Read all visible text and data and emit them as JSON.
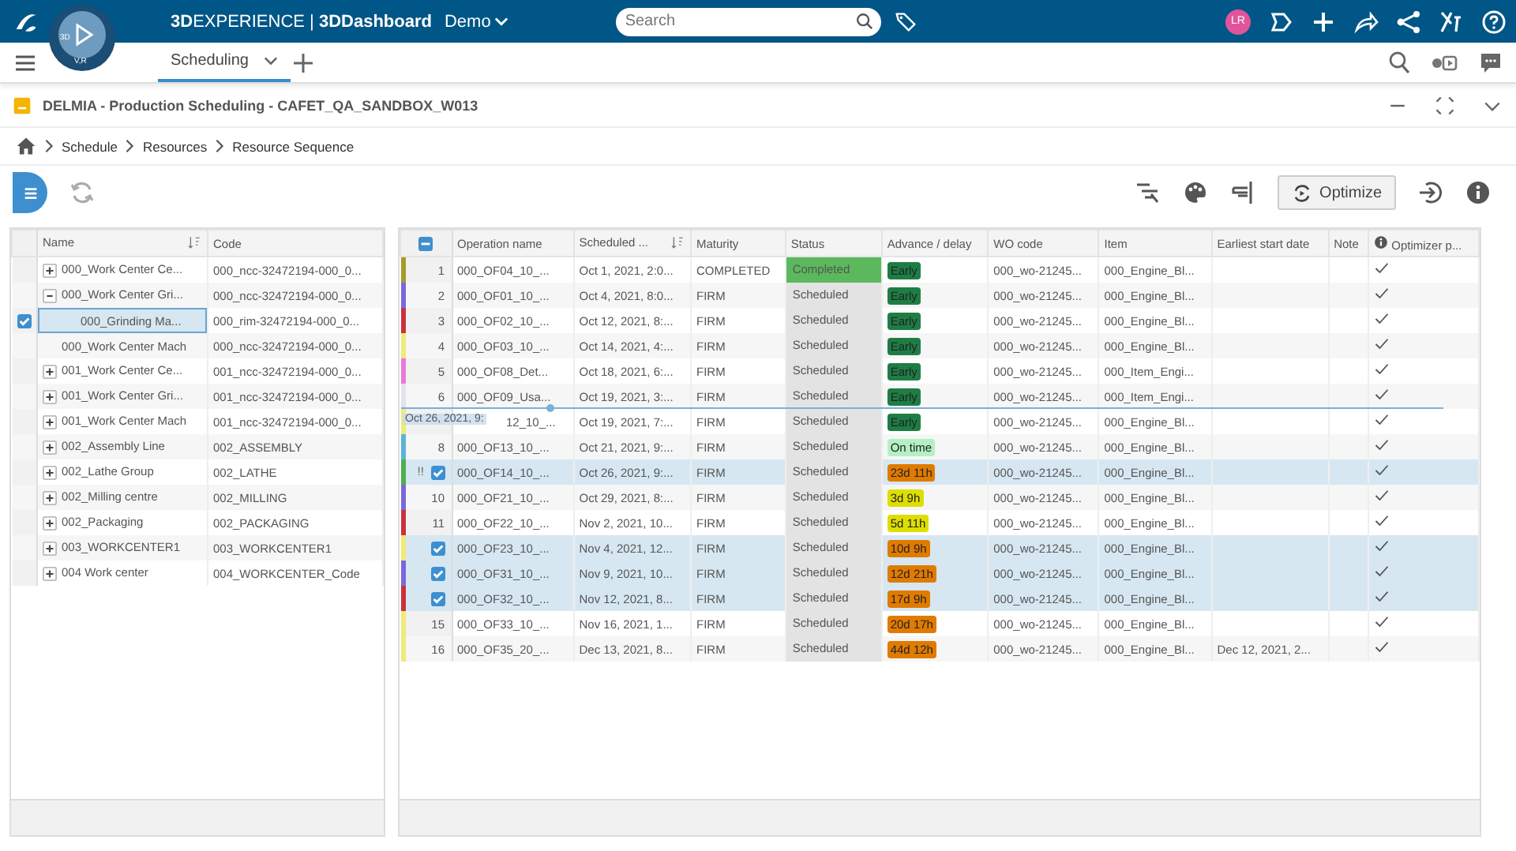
{
  "topbar": {
    "compass_labels": [
      "3D",
      "V,R"
    ],
    "brand": "**3D**EXPERIENCE | **3DDashboard**",
    "space": "Demo",
    "search": {
      "placeholder": "Search"
    },
    "avatar": "LR"
  },
  "tabs": [
    {
      "label": "Scheduling",
      "selected": true
    }
  ],
  "widget": {
    "title": "DELMIA - Production Scheduling - CAFET_QA_SANDBOX_W013"
  },
  "breadcrumb": [
    "Schedule",
    "Resources",
    "Resource Sequence"
  ],
  "toolbar": {
    "optimize": "Optimize"
  },
  "resources": {
    "columns": [
      "Name",
      "Code"
    ],
    "items": [
      {
        "name": "000_Work Center Ce...",
        "code": "000_ncc-32472194-000_0...",
        "expanded": false,
        "selected": false
      },
      {
        "name": "000_Work Center Gri...",
        "code": "000_ncc-32472194-000_0...",
        "expanded": true,
        "selected": false,
        "children": [
          {
            "name": "000_Grinding Ma...",
            "code": "000_rim-32472194-000_0...",
            "selected": true
          }
        ]
      },
      {
        "name": "000_Work Center Mach",
        "code": "000_ncc-32472194-000_0...",
        "selected": false
      },
      {
        "name": "001_Work Center Ce...",
        "code": "001_ncc-32472194-000_0...",
        "expanded": false,
        "selected": false
      },
      {
        "name": "001_Work Center Gri...",
        "code": "001_ncc-32472194-000_0...",
        "expanded": false,
        "selected": false
      },
      {
        "name": "001_Work Center Mach",
        "code": "001_ncc-32472194-000_0...",
        "expanded": false,
        "selected": false
      },
      {
        "name": "002_Assembly Line",
        "code": "002_ASSEMBLY",
        "expanded": false,
        "selected": false
      },
      {
        "name": "002_Lathe Group",
        "code": "002_LATHE",
        "expanded": false,
        "selected": false
      },
      {
        "name": "002_Milling centre",
        "code": "002_MILLING",
        "expanded": false,
        "selected": false
      },
      {
        "name": "002_Packaging",
        "code": "002_PACKAGING",
        "expanded": false,
        "selected": false
      },
      {
        "name": "003_WORKCENTER1",
        "code": "003_WORKCENTER1",
        "expanded": false,
        "selected": false
      },
      {
        "name": "004 Work center",
        "code": "004_WORKCENTER_Code",
        "expanded": false,
        "selected": false
      }
    ]
  },
  "operations": {
    "columns": [
      "Operation name",
      "Scheduled ...",
      "Maturity",
      "Status",
      "Advance / delay",
      "WO code",
      "Item",
      "Earliest start date",
      "Note",
      "Optimizer p..."
    ],
    "drag_label": "Oct 26, 2021, 9:",
    "select_all": {
      "indeterminate": true
    },
    "rows": [
      {
        "n": "1",
        "color": "#a89a2a",
        "selected": false,
        "op": "000_OF04_10_...",
        "sched": "Oct 1, 2021, 2:0...",
        "maturity": "COMPLETED",
        "status": {
          "text": "Completed",
          "color": "#5cb85c"
        },
        "advance": {
          "text": "Early",
          "color": "#1e7d45"
        },
        "wo": "000_wo-21245...",
        "item": "000_Engine_Bl...",
        "optimized": true
      },
      {
        "n": "2",
        "color": "#7b68d9",
        "selected": false,
        "op": "000_OF01_10_...",
        "sched": "Oct 4, 2021, 8:0...",
        "maturity": "FIRM",
        "status": {
          "text": "Scheduled",
          "color": "#e3e3e3"
        },
        "advance": {
          "text": "Early",
          "color": "#1e7d45"
        },
        "wo": "000_wo-21245...",
        "item": "000_Engine_Bl...",
        "optimized": true
      },
      {
        "n": "3",
        "color": "#c8323c",
        "selected": false,
        "op": "000_OF02_10_...",
        "sched": "Oct 12, 2021, 8:...",
        "maturity": "FIRM",
        "status": {
          "text": "Scheduled",
          "color": "#e3e3e3"
        },
        "advance": {
          "text": "Early",
          "color": "#1e7d45"
        },
        "wo": "000_wo-21245...",
        "item": "000_Engine_Bl...",
        "optimized": true
      },
      {
        "n": "4",
        "color": "#f0ea78",
        "selected": false,
        "op": "000_OF03_10_...",
        "sched": "Oct 14, 2021, 4:...",
        "maturity": "FIRM",
        "status": {
          "text": "Scheduled",
          "color": "#e3e3e3"
        },
        "advance": {
          "text": "Early",
          "color": "#1e7d45"
        },
        "wo": "000_wo-21245...",
        "item": "000_Engine_Bl...",
        "optimized": true
      },
      {
        "n": "5",
        "color": "#e87ad6",
        "selected": false,
        "op": "000_OF08_Det...",
        "sched": "Oct 18, 2021, 6:...",
        "maturity": "FIRM",
        "status": {
          "text": "Scheduled",
          "color": "#e3e3e3"
        },
        "advance": {
          "text": "Early",
          "color": "#1e7d45"
        },
        "wo": "000_wo-21245...",
        "item": "000_Item_Engi...",
        "optimized": true
      },
      {
        "n": "6",
        "color": "#e2e2ee",
        "selected": false,
        "op": "000_OF09_Usa...",
        "sched": "Oct 19, 2021, 3:...",
        "maturity": "FIRM",
        "status": {
          "text": "Scheduled",
          "color": "#e3e3e3"
        },
        "advance": {
          "text": "Early",
          "color": "#1e7d45"
        },
        "wo": "000_wo-21245...",
        "item": "000_Item_Engi...",
        "optimized": true
      },
      {
        "color": "#f0ea78",
        "selected": false,
        "drop_target": true,
        "op": "12_10_...",
        "sched": "Oct 19, 2021, 7:...",
        "maturity": "FIRM",
        "status": {
          "text": "Scheduled",
          "color": "#e3e3e3"
        },
        "advance": {
          "text": "Early",
          "color": "#1e7d45"
        },
        "wo": "000_wo-21245...",
        "item": "000_Engine_Bl...",
        "optimized": true
      },
      {
        "n": "8",
        "color": "#5ab4d8",
        "selected": false,
        "op": "000_OF13_10_...",
        "sched": "Oct 21, 2021, 9:...",
        "maturity": "FIRM",
        "status": {
          "text": "Scheduled",
          "color": "#e3e3e3"
        },
        "advance": {
          "text": "On time",
          "color": "#b4f0c4"
        },
        "wo": "000_wo-21245...",
        "item": "000_Engine_Bl...",
        "optimized": true
      },
      {
        "color": "#4caf50",
        "selected": true,
        "warning": "!!",
        "op": "000_OF14_10_...",
        "sched": "Oct 26, 2021, 9:...",
        "maturity": "FIRM",
        "status": {
          "text": "Scheduled",
          "color": "#e3e3e3"
        },
        "advance": {
          "text": "23d 11h",
          "color": "#e07b00"
        },
        "wo": "000_wo-21245...",
        "item": "000_Engine_Bl...",
        "optimized": true
      },
      {
        "n": "10",
        "color": "#7b68d9",
        "selected": false,
        "op": "000_OF21_10_...",
        "sched": "Oct 29, 2021, 8:...",
        "maturity": "FIRM",
        "status": {
          "text": "Scheduled",
          "color": "#e3e3e3"
        },
        "advance": {
          "text": "3d 9h",
          "color": "#dede00"
        },
        "wo": "000_wo-21245...",
        "item": "000_Engine_Bl...",
        "optimized": true
      },
      {
        "n": "11",
        "color": "#c8323c",
        "selected": false,
        "op": "000_OF22_10_...",
        "sched": "Nov 2, 2021, 10...",
        "maturity": "FIRM",
        "status": {
          "text": "Scheduled",
          "color": "#e3e3e3"
        },
        "advance": {
          "text": "5d 11h",
          "color": "#dede00"
        },
        "wo": "000_wo-21245...",
        "item": "000_Engine_Bl...",
        "optimized": true
      },
      {
        "color": "#f0ea78",
        "selected": true,
        "op": "000_OF23_10_...",
        "sched": "Nov 4, 2021, 12...",
        "maturity": "FIRM",
        "status": {
          "text": "Scheduled",
          "color": "#e3e3e3"
        },
        "advance": {
          "text": "10d 9h",
          "color": "#e07b00"
        },
        "wo": "000_wo-21245...",
        "item": "000_Engine_Bl...",
        "optimized": true
      },
      {
        "color": "#7b68d9",
        "selected": true,
        "op": "000_OF31_10_...",
        "sched": "Nov 9, 2021, 10...",
        "maturity": "FIRM",
        "status": {
          "text": "Scheduled",
          "color": "#e3e3e3"
        },
        "advance": {
          "text": "12d 21h",
          "color": "#e07b00"
        },
        "wo": "000_wo-21245...",
        "item": "000_Engine_Bl...",
        "optimized": true
      },
      {
        "color": "#c8323c",
        "selected": true,
        "op": "000_OF32_10_...",
        "sched": "Nov 12, 2021, 8...",
        "maturity": "FIRM",
        "status": {
          "text": "Scheduled",
          "color": "#e3e3e3"
        },
        "advance": {
          "text": "17d 9h",
          "color": "#e07b00"
        },
        "wo": "000_wo-21245...",
        "item": "000_Engine_Bl...",
        "optimized": true
      },
      {
        "n": "15",
        "color": "#f0ea78",
        "selected": false,
        "op": "000_OF33_10_...",
        "sched": "Nov 16, 2021, 1...",
        "maturity": "FIRM",
        "status": {
          "text": "Scheduled",
          "color": "#e3e3e3"
        },
        "advance": {
          "text": "20d 17h",
          "color": "#e07b00"
        },
        "wo": "000_wo-21245...",
        "item": "000_Engine_Bl...",
        "optimized": true
      },
      {
        "n": "16",
        "color": "#f0ea78",
        "selected": false,
        "op": "000_OF35_20_...",
        "sched": "Dec 13, 2021, 8...",
        "maturity": "FIRM",
        "status": {
          "text": "Scheduled",
          "color": "#e3e3e3"
        },
        "advance": {
          "text": "44d 12h",
          "color": "#e07b00"
        },
        "wo": "000_wo-21245...",
        "item": "000_Engine_Bl...",
        "earliest": "Dec 12, 2021, 2...",
        "optimized": true
      }
    ]
  }
}
